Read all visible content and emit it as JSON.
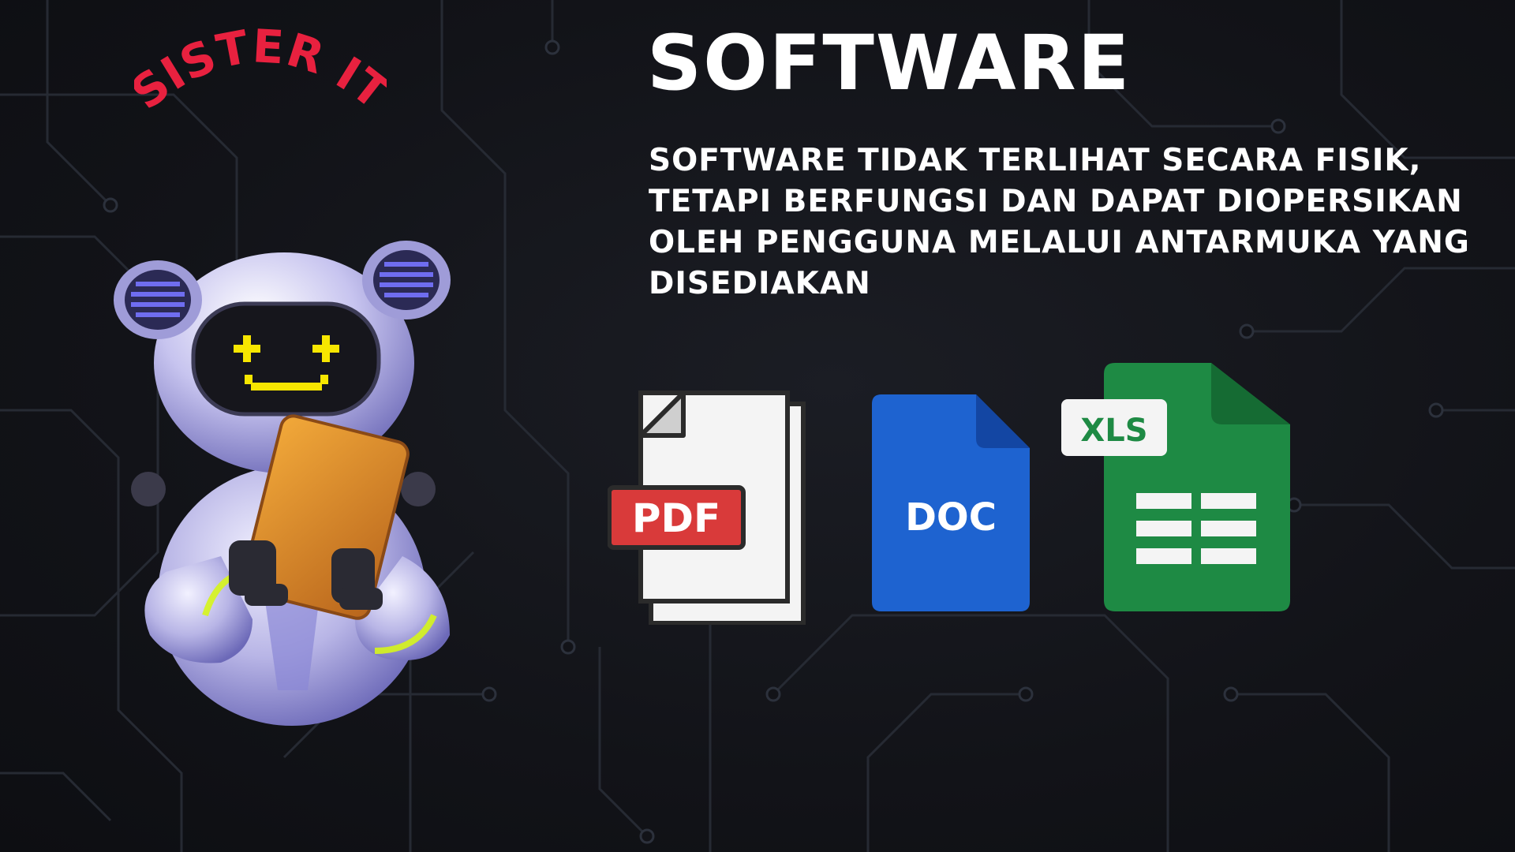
{
  "slide": {
    "brand": "SISTER IT",
    "title": "SOFTWARE",
    "description": "SOFTWARE TIDAK TERLIHAT SECARA FISIK, TETAPI BERFUNGSI DAN DAPAT DIOPERSIKAN OLEH PENGGUNA MELALUI ANTARMUKA YANG DISEDIAKAN"
  },
  "file_icons": {
    "pdf": {
      "label": "PDF",
      "badge_color": "#d93a3a",
      "icon": "pdf-file-icon"
    },
    "doc": {
      "label": "DOC",
      "body_color": "#1e63d0",
      "icon": "doc-file-icon"
    },
    "xls": {
      "label": "XLS",
      "body_color": "#1e8a44",
      "icon": "xls-file-icon"
    }
  },
  "colors": {
    "background": "#121318",
    "brand_red": "#e8213f",
    "text": "#ffffff",
    "robot_face": "#f7e600",
    "robot_glow": "#d6f51b"
  }
}
